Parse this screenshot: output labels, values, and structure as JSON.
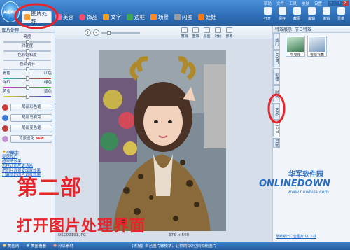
{
  "app": {
    "logo_text": "美图秀秀"
  },
  "main_tabs": [
    {
      "label": "图片处理",
      "active": true,
      "icon": "picture-icon",
      "color": "#ff9d2e"
    },
    {
      "label": "美容",
      "active": false,
      "icon": "beauty-icon",
      "color": "#ff6a9a"
    },
    {
      "label": "饰品",
      "active": false,
      "icon": "heart-icon",
      "color": "#ff4a6a"
    },
    {
      "label": "文字",
      "active": false,
      "icon": "text-icon",
      "color": "#f0a020"
    },
    {
      "label": "边框",
      "active": false,
      "icon": "frame-icon",
      "color": "#3fa84f"
    },
    {
      "label": "场景",
      "active": false,
      "icon": "scene-icon",
      "color": "#ff8a2a"
    },
    {
      "label": "闪图",
      "active": false,
      "icon": "flash-icon",
      "color": "#999999"
    },
    {
      "label": "娃娃",
      "active": false,
      "icon": "doll-icon",
      "color": "#ff7a1a"
    }
  ],
  "window_menu": [
    "帮助",
    "文件",
    "工具",
    "皮肤",
    "设置"
  ],
  "toolbar": [
    "打开",
    "保存",
    "截图",
    "编辑",
    "撤销",
    "重做"
  ],
  "left": {
    "header": "图片处理",
    "sliders": [
      {
        "label": "亮度",
        "value": 0.5
      },
      {
        "label": "对比度",
        "value": 0.5
      },
      {
        "label": "色彩饱和度",
        "value": 0.5
      },
      {
        "label": "色调调节",
        "value": 0.5
      }
    ],
    "color_balance": [
      {
        "left": "青色",
        "right": "红色",
        "value": 0.5
      },
      {
        "left": "洋红",
        "right": "绿色",
        "value": 0.5
      },
      {
        "left": "黄色",
        "right": "蓝色",
        "value": 0.5
      }
    ],
    "buttons": [
      {
        "label": "局部彩色笔",
        "color": "#d23a3a"
      },
      {
        "label": "局部马赛克",
        "color": "#3a7ad2"
      },
      {
        "label": "局部变色笔",
        "color": "#c04040"
      },
      {
        "label": "背景虚化",
        "color": "#c090d0",
        "badge": "NEW"
      }
    ],
    "tip_title": "小贴士",
    "links": [
      "提速技巧",
      "超眼睛效果",
      "怎样让图片更清晰",
      "把图片背景变成双效果",
      "已截图的图片背景效果"
    ]
  },
  "canvas": {
    "zoom_in": "+",
    "zoom_out": "-",
    "tools": [
      "撤销",
      "重做",
      "原图",
      "对比",
      "预览"
    ],
    "filename": "DSC09191.JPG",
    "dimensions": "375 × 500"
  },
  "right": {
    "header_left": "特效展示",
    "header_right": "节日特效",
    "tabs": [
      "热门",
      "LOMO",
      "影楼",
      "时尚",
      "艺术",
      "节日",
      "其他"
    ],
    "active_tab": "节日",
    "thumbnails": [
      "平安夜",
      "雪花飞舞"
    ],
    "footer": "最新新出广告图片 00下载"
  },
  "bottom": {
    "items": [
      "美图网",
      "美图看看",
      "分享素材"
    ],
    "news": "【热报】自己图片做模块，让你的QQ空间相册图片"
  },
  "overlay": {
    "line1": "第二部",
    "line2": "打开图片处理界面",
    "watermark_cn": "华军软件园",
    "watermark_en": "ONLINEDOWN",
    "watermark_url": "www.newhua.com"
  },
  "colors": {
    "accent": "#2f6fb8",
    "annotation_red": "#e8242b"
  }
}
